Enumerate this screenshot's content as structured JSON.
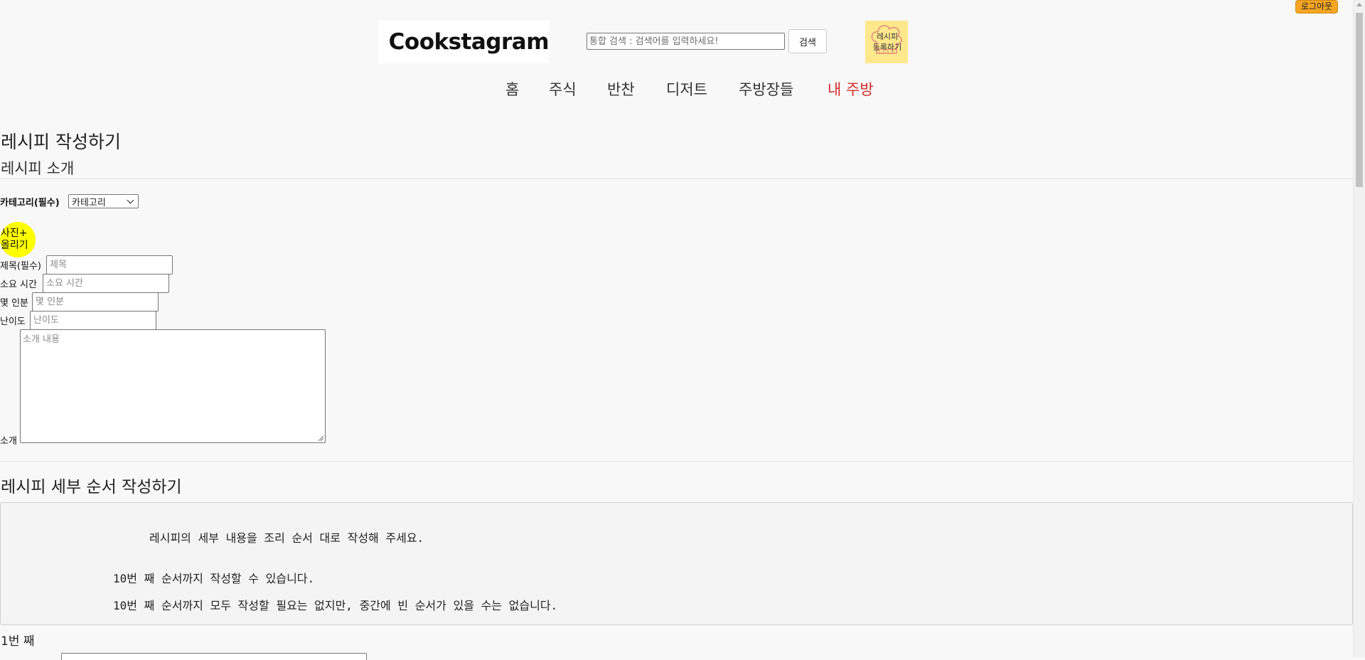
{
  "header": {
    "logout_label": "로그아웃",
    "logo_text": "Cookstagram",
    "search": {
      "placeholder": "통합 검색 : 검색어를 입력하세요!",
      "value": ""
    },
    "search_button_label": "검색",
    "register_recipe_label_line1": "레시피",
    "register_recipe_label_line2": "등록하기"
  },
  "nav": {
    "items": [
      {
        "label": "홈",
        "active": false
      },
      {
        "label": "주식",
        "active": false
      },
      {
        "label": "반찬",
        "active": false
      },
      {
        "label": "디저트",
        "active": false
      },
      {
        "label": "주방장들",
        "active": false
      },
      {
        "label": "내 주방",
        "active": true
      }
    ]
  },
  "form": {
    "page_title": "레시피 작성하기",
    "intro_section_title": "레시피 소개",
    "category": {
      "label": "카테고리(필수)",
      "selected": "카테고리"
    },
    "photo_upload_line1": "사진+",
    "photo_upload_line2": "올리기",
    "fields": {
      "title": {
        "label": "제목(필수)",
        "placeholder": "제목"
      },
      "time": {
        "label": "소요 시간",
        "placeholder": "소요 시간"
      },
      "servings": {
        "label": "몇 인분",
        "placeholder": "몇 인분"
      },
      "difficulty": {
        "label": "난이도",
        "placeholder": "난이도"
      },
      "intro": {
        "label": "소개",
        "placeholder": "소개 내용"
      }
    }
  },
  "steps": {
    "section_title": "레시피 세부 순서 작성하기",
    "guide": [
      "레시피의 세부 내용을 조리 순서 대로 작성해 주세요.",
      "10번 째 순서까지 작성할 수 있습니다.",
      "10번 째 순서까지 모두 작성할 필요는 없지만, 중간에 빈 순서가 있을 수는 없습니다."
    ],
    "first_step_label": "1번 째"
  },
  "colors": {
    "active_nav": "#d62b2b",
    "logout_bg": "#f5a623",
    "photo_upload_bg": "#ffff00",
    "register_bg": "#ffe88c"
  }
}
